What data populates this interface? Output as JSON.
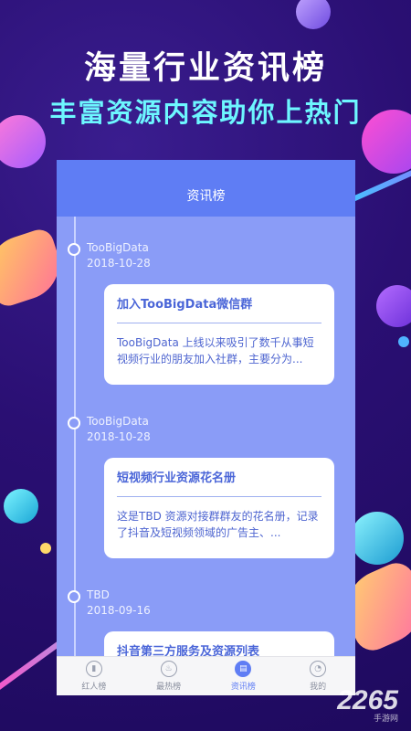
{
  "promo": {
    "headline": "海量行业资讯榜",
    "subheadline": "丰富资源内容助你上热门"
  },
  "app": {
    "header_title": "资讯榜",
    "entries": [
      {
        "source": "TooBigData",
        "date": "2018-10-28",
        "title": "加入TooBigData微信群",
        "summary": "TooBigData 上线以来吸引了数千从事短视频行业的朋友加入社群，主要分为..."
      },
      {
        "source": "TooBigData",
        "date": "2018-10-28",
        "title": "短视频行业资源花名册",
        "summary": "这是TBD 资源对接群群友的花名册，记录了抖音及短视频领域的广告主、..."
      },
      {
        "source": "TBD",
        "date": "2018-09-16",
        "title": "抖音第三方服务及资源列表",
        "summary": ""
      }
    ],
    "tabs": [
      {
        "label": "红人榜",
        "icon": "chart-icon",
        "glyph": "▮"
      },
      {
        "label": "最热榜",
        "icon": "flame-icon",
        "glyph": "♨"
      },
      {
        "label": "资讯榜",
        "icon": "book-icon",
        "glyph": "▤"
      },
      {
        "label": "我的",
        "icon": "user-icon",
        "glyph": "◔"
      }
    ],
    "active_tab": "资讯榜"
  },
  "watermark": {
    "brand": "2265",
    "sub": "手游网"
  },
  "colors": {
    "background": "#2a0f73",
    "accent_cyan": "#6df7ff",
    "header_blue": "#5f7df4",
    "list_bg": "#8a9cf7"
  }
}
